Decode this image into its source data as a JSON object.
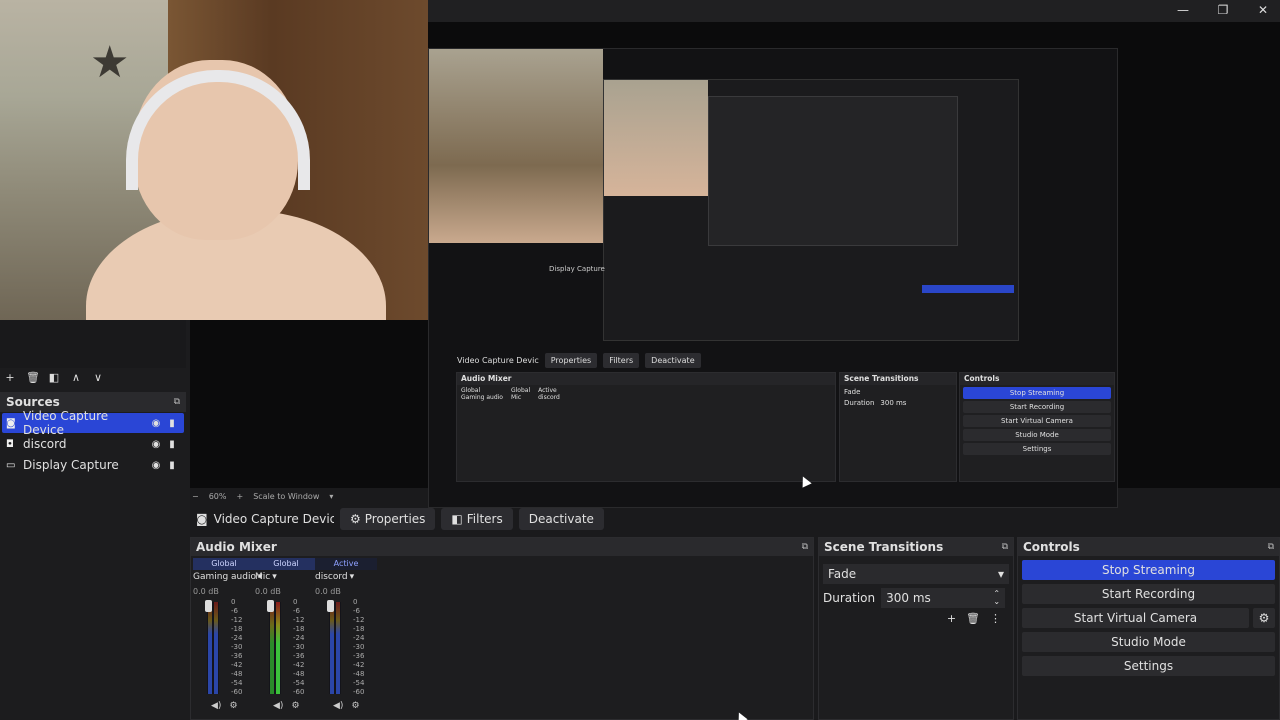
{
  "window": {
    "controls": {
      "minimize": "—",
      "maximize": "❐",
      "close": "✕"
    }
  },
  "preview": {
    "nested": {
      "source_bar": {
        "name": "Video Capture Devic",
        "properties": "Properties",
        "filters": "Filters",
        "deactivate": "Deactivate"
      },
      "display_label": "Display Capture",
      "mixer_title": "Audio Mixer",
      "transitions_title": "Scene Transitions",
      "transition_value": "Fade",
      "duration_label": "Duration",
      "duration_value": "300 ms",
      "controls_title": "Controls",
      "buttons": [
        "Stop Streaming",
        "Start Recording",
        "Start Virtual Camera",
        "Studio Mode",
        "Settings"
      ],
      "channels": [
        {
          "tag": "Global",
          "name": "Gaming audio"
        },
        {
          "tag": "Global",
          "name": "Mic"
        },
        {
          "tag": "Active",
          "name": "discord"
        }
      ]
    }
  },
  "scene_toolbar": {
    "add": "+",
    "remove": "🗑",
    "filter": "◧",
    "up": "∧",
    "down": "∨"
  },
  "sources": {
    "title": "Sources",
    "items": [
      {
        "label": "Video Capture Device",
        "icon": "camera-icon",
        "selected": true
      },
      {
        "label": "discord",
        "icon": "speaker-icon",
        "selected": false
      },
      {
        "label": "Display Capture",
        "icon": "monitor-icon",
        "selected": false
      }
    ]
  },
  "zoom_bar": {
    "minus": "−",
    "zoom": "60%",
    "plus": "+",
    "mode": "Scale to Window"
  },
  "source_bar": {
    "name": "Video Capture Devic",
    "properties": "Properties",
    "filters": "Filters",
    "deactivate": "Deactivate"
  },
  "audio_mixer": {
    "title": "Audio Mixer",
    "channels": [
      {
        "tag": "Global",
        "name": "Gaming audio",
        "db": "0.0 dB",
        "level": 0.0
      },
      {
        "tag": "Global",
        "name": "Mic",
        "db": "0.0 dB",
        "level": 0.55
      },
      {
        "tag": "Active",
        "name": "discord",
        "db": "0.0 dB",
        "level": 0.0
      }
    ],
    "scale": [
      "0",
      "-6",
      "-12",
      "-18",
      "-24",
      "-30",
      "-36",
      "-42",
      "-48",
      "-54",
      "-60"
    ]
  },
  "scene_transitions": {
    "title": "Scene Transitions",
    "transition": "Fade",
    "duration_label": "Duration",
    "duration_value": "300 ms"
  },
  "controls": {
    "title": "Controls",
    "stop_streaming": "Stop Streaming",
    "start_recording": "Start Recording",
    "start_virtual_camera": "Start Virtual Camera",
    "studio_mode": "Studio Mode",
    "settings": "Settings"
  },
  "colors": {
    "accent": "#2a46d6",
    "bg": "#1a1a1c",
    "panel": "#1d1d1f"
  }
}
